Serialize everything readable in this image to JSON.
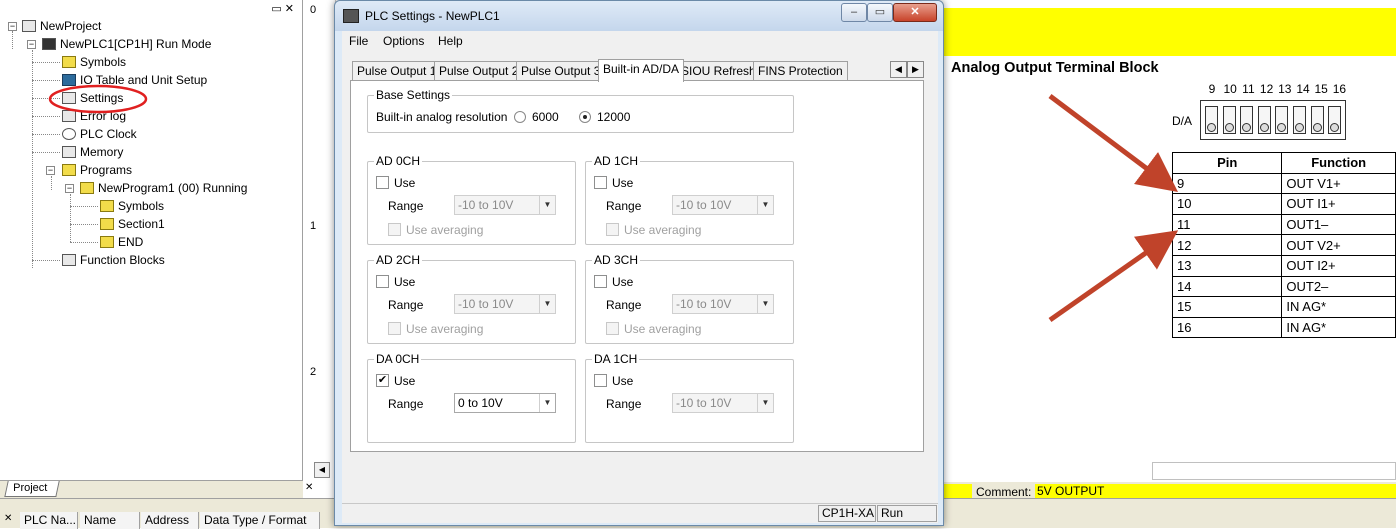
{
  "project_tree": {
    "root": "NewProject",
    "plc": "NewPLC1[CP1H] Run Mode",
    "items": [
      "Symbols",
      "IO Table and Unit Setup",
      "Settings",
      "Error log",
      "PLC Clock",
      "Memory",
      "Programs"
    ],
    "program": "NewProgram1 (00) Running",
    "program_items": [
      "Symbols",
      "Section1",
      "END"
    ],
    "function_blocks": "Function Blocks",
    "tab_label": "Project"
  },
  "ladder": {
    "rung_numbers": [
      "0",
      "1",
      "2"
    ]
  },
  "bottom_table": {
    "headers": [
      "PLC Na...",
      "Name",
      "Address",
      "Data Type / Format"
    ]
  },
  "dialog": {
    "title": "PLC Settings - NewPLC1",
    "menu": [
      "File",
      "Options",
      "Help"
    ],
    "tabs": [
      "Pulse Output 1",
      "Pulse Output 2",
      "Pulse Output 3",
      "Built-in AD/DA",
      "SIOU Refresh",
      "FINS Protection"
    ],
    "base_settings": {
      "title": "Base Settings",
      "label": "Built-in analog resolution",
      "options": [
        "6000",
        "12000"
      ],
      "selected": "12000"
    },
    "channels": [
      {
        "title": "AD 0CH",
        "use": false,
        "range": "-10 to 10V"
      },
      {
        "title": "AD 1CH",
        "use": false,
        "range": "-10 to 10V"
      },
      {
        "title": "AD 2CH",
        "use": false,
        "range": "-10 to 10V"
      },
      {
        "title": "AD 3CH",
        "use": false,
        "range": "-10 to 10V"
      },
      {
        "title": "DA 0CH",
        "use": true,
        "range": "0 to 10V"
      },
      {
        "title": "DA 1CH",
        "use": false,
        "range": "-10 to 10V"
      }
    ],
    "use_label": "Use",
    "range_label": "Range",
    "averaging_label": "Use averaging",
    "status": {
      "model": "CP1H-XA",
      "mode": "Run"
    }
  },
  "terminal_diagram": {
    "title": "Analog Output Terminal Block",
    "pin_numbers": [
      "9",
      "10",
      "11",
      "12",
      "13",
      "14",
      "15",
      "16"
    ],
    "row_label": "D/A",
    "headers": [
      "Pin",
      "Function"
    ],
    "rows": [
      [
        "9",
        "OUT V1+"
      ],
      [
        "10",
        "OUT I1+"
      ],
      [
        "11",
        "OUT1–"
      ],
      [
        "12",
        "OUT V2+"
      ],
      [
        "13",
        "OUT I2+"
      ],
      [
        "14",
        "OUT2–"
      ],
      [
        "15",
        "IN AG*"
      ],
      [
        "16",
        "IN AG*"
      ]
    ],
    "arrow_color": "#c0432a"
  },
  "comment": {
    "label": "Comment:",
    "value": "5V OUTPUT"
  },
  "colors": {
    "highlight_yellow": "#ffff00",
    "annotation_red": "#e02020"
  }
}
